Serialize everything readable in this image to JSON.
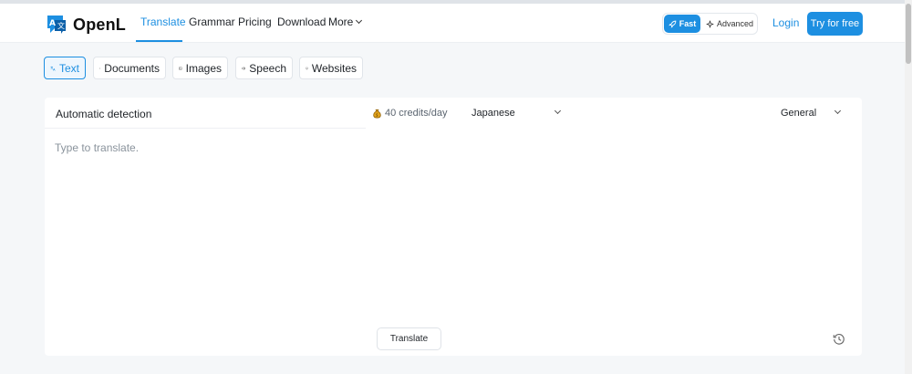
{
  "brand": {
    "name": "OpenL",
    "accent": "#1d8fe1"
  },
  "nav": {
    "links": [
      {
        "label": "Translate",
        "active": true
      },
      {
        "label": "Grammar"
      },
      {
        "label": "Pricing"
      },
      {
        "label": "Download"
      },
      {
        "label": "More"
      }
    ],
    "modes": {
      "fast": "Fast",
      "advanced": "Advanced"
    },
    "login": "Login",
    "cta": "Try for free"
  },
  "tabs": [
    {
      "label": "Text",
      "icon": "translate-icon",
      "active": true
    },
    {
      "label": "Documents",
      "icon": "document-icon"
    },
    {
      "label": "Images",
      "icon": "image-icon"
    },
    {
      "label": "Speech",
      "icon": "speaker-icon"
    },
    {
      "label": "Websites",
      "icon": "monitor-icon"
    }
  ],
  "translator": {
    "source_language": "Automatic detection",
    "credits": "40 credits/day",
    "target_language": "Japanese",
    "style": "General",
    "placeholder": "Type to translate.",
    "translate_button": "Translate"
  }
}
